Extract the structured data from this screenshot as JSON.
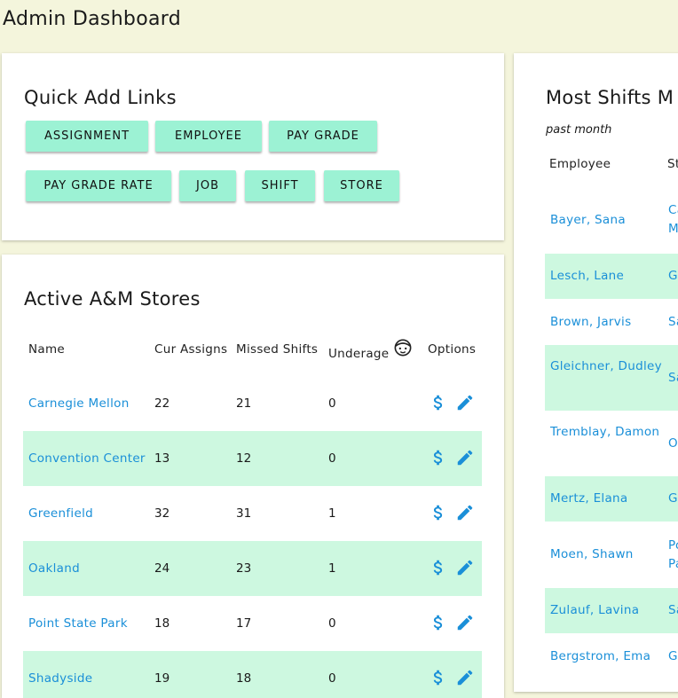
{
  "page": {
    "title": "Admin Dashboard"
  },
  "quick_add": {
    "title": "Quick Add Links",
    "buttons": [
      "ASSIGNMENT",
      "EMPLOYEE",
      "PAY GRADE",
      "PAY GRADE RATE",
      "JOB",
      "SHIFT",
      "STORE"
    ]
  },
  "stores": {
    "title": "Active A&M Stores",
    "headers": {
      "name": "Name",
      "cur": "Cur Assigns",
      "missed": "Missed Shifts",
      "underage": "Underage",
      "options": "Options"
    },
    "rows": [
      {
        "name": "Carnegie Mellon",
        "cur": "22",
        "missed": "21",
        "underage": "0"
      },
      {
        "name": "Convention Center",
        "cur": "13",
        "missed": "12",
        "underage": "0"
      },
      {
        "name": "Greenfield",
        "cur": "32",
        "missed": "31",
        "underage": "1"
      },
      {
        "name": "Oakland",
        "cur": "24",
        "missed": "23",
        "underage": "1"
      },
      {
        "name": "Point State Park",
        "cur": "18",
        "missed": "17",
        "underage": "0"
      },
      {
        "name": "Shadyside",
        "cur": "19",
        "missed": "18",
        "underage": "0"
      }
    ],
    "icons": {
      "pay": "dollar-icon",
      "edit": "pencil-icon",
      "underage": "child-face-icon"
    }
  },
  "shifts": {
    "title": "Most Shifts M",
    "subtitle": "past month",
    "headers": {
      "employee": "Employee",
      "store": "St"
    },
    "rows": [
      {
        "employee": "Bayer, Sana",
        "store": [
          "Ca",
          "M"
        ]
      },
      {
        "employee": "Lesch, Lane",
        "store": [
          "G"
        ]
      },
      {
        "employee": "Brown, Jarvis",
        "store": [
          "Sa"
        ]
      },
      {
        "employee": "Gleichner, Dudley",
        "store": [
          "Sa"
        ]
      },
      {
        "employee": "Tremblay, Damon",
        "store": [
          "O"
        ]
      },
      {
        "employee": "Mertz, Elana",
        "store": [
          "G"
        ]
      },
      {
        "employee": "Moen, Shawn",
        "store": [
          "Po",
          "Pa"
        ]
      },
      {
        "employee": "Zulauf, Lavina",
        "store": [
          "Sa"
        ]
      },
      {
        "employee": "Bergstrom, Ema",
        "store": [
          "G"
        ]
      }
    ]
  },
  "colors": {
    "background": "#f4f5dc",
    "button": "#9cf2d4",
    "row_alt": "#cdf8e0",
    "link": "#1a8fd8"
  }
}
